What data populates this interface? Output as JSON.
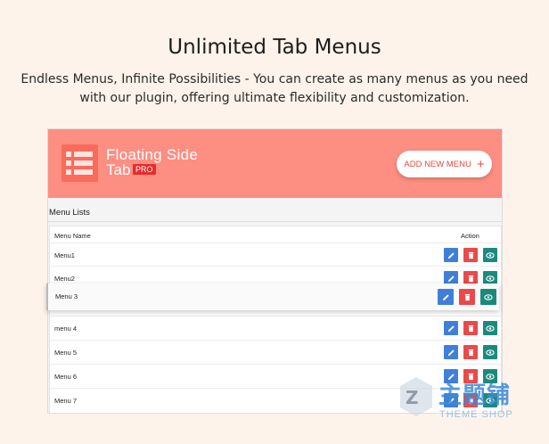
{
  "hero": {
    "title": "Unlimited Tab Menus",
    "subtitle": "Endless Menus, Infinite Possibilities - You can create as many menus as you need with our plugin, offering ultimate flexibility and customization."
  },
  "app": {
    "brand_line1": "Floating Side",
    "brand_line2": "Tab",
    "badge": "PRO",
    "add_button_label": "ADD NEW MENU",
    "add_button_icon": "plus-icon"
  },
  "list": {
    "title": "Menu Lists",
    "columns": {
      "name": "Menu Name",
      "action": "Action"
    },
    "rows": [
      {
        "name": "Menu1"
      },
      {
        "name": "Menu2"
      },
      {
        "name": "menu 4"
      },
      {
        "name": "Menu 5"
      },
      {
        "name": "Menu 6"
      },
      {
        "name": "Menu 7"
      }
    ],
    "dragged_row": {
      "name": "Menu 3"
    },
    "action_icons": [
      "pencil-icon",
      "trash-icon",
      "eye-icon"
    ]
  },
  "watermark": {
    "text_cn": "主题铺",
    "text_en": "THEME SHOP"
  },
  "colors": {
    "page_bg": "#fdf3ea",
    "header_bg": "#fd8e82",
    "accent": "#e8483b",
    "edit_btn": "#3f7fd9",
    "delete_btn": "#e84a4a",
    "view_btn": "#1b8a7d"
  }
}
